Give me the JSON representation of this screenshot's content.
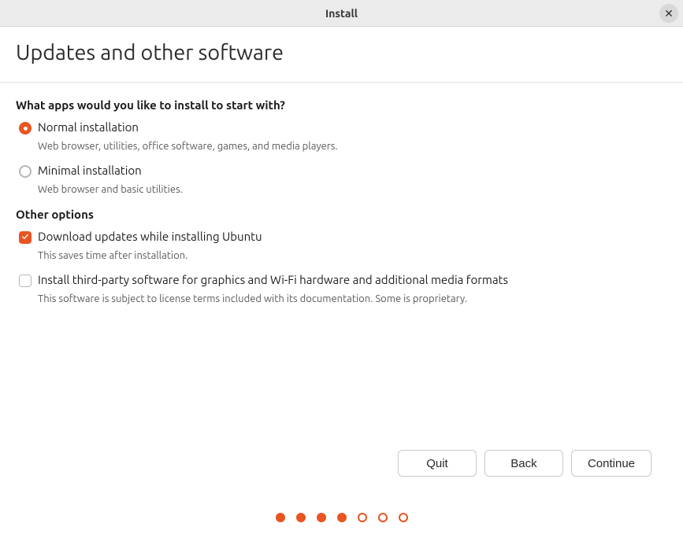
{
  "window": {
    "title": "Install"
  },
  "page": {
    "title": "Updates and other software"
  },
  "sections": {
    "apps_question": "What apps would you like to install to start with?",
    "normal": {
      "label": "Normal installation",
      "desc": "Web browser, utilities, office software, games, and media players."
    },
    "minimal": {
      "label": "Minimal installation",
      "desc": "Web browser and basic utilities."
    },
    "other_options_label": "Other options",
    "download_updates": {
      "label": "Download updates while installing Ubuntu",
      "desc": "This saves time after installation."
    },
    "third_party": {
      "label": "Install third-party software for graphics and Wi-Fi hardware and additional media formats",
      "desc": "This software is subject to license terms included with its documentation. Some is proprietary."
    }
  },
  "buttons": {
    "quit": "Quit",
    "back": "Back",
    "continue": "Continue"
  }
}
